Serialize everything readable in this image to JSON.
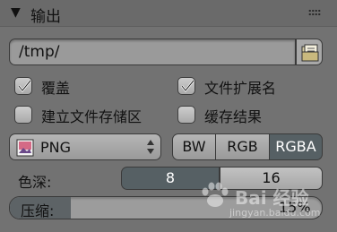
{
  "header": {
    "arrow": "▼",
    "title": "输出"
  },
  "output_path": {
    "value": "/tmp/"
  },
  "checkboxes": [
    {
      "label": "覆盖",
      "checked": true
    },
    {
      "label": "文件扩展名",
      "checked": true
    },
    {
      "label": "建立文件存储区",
      "checked": false
    },
    {
      "label": "缓存结果",
      "checked": false
    }
  ],
  "file_format": {
    "selected": "PNG"
  },
  "color_mode": {
    "options": [
      "BW",
      "RGB",
      "RGBA"
    ],
    "selected": "RGBA"
  },
  "color_depth": {
    "label": "色深:",
    "options": [
      "8",
      "16"
    ],
    "selected": "8"
  },
  "compression": {
    "label": "压缩:",
    "value_text": "15%",
    "fraction": 0.15
  },
  "watermark": {
    "text": "Bai 经验",
    "url": "jingyan.baidu.com"
  },
  "colors": {
    "selected": "#566064",
    "panel": "#727272"
  }
}
